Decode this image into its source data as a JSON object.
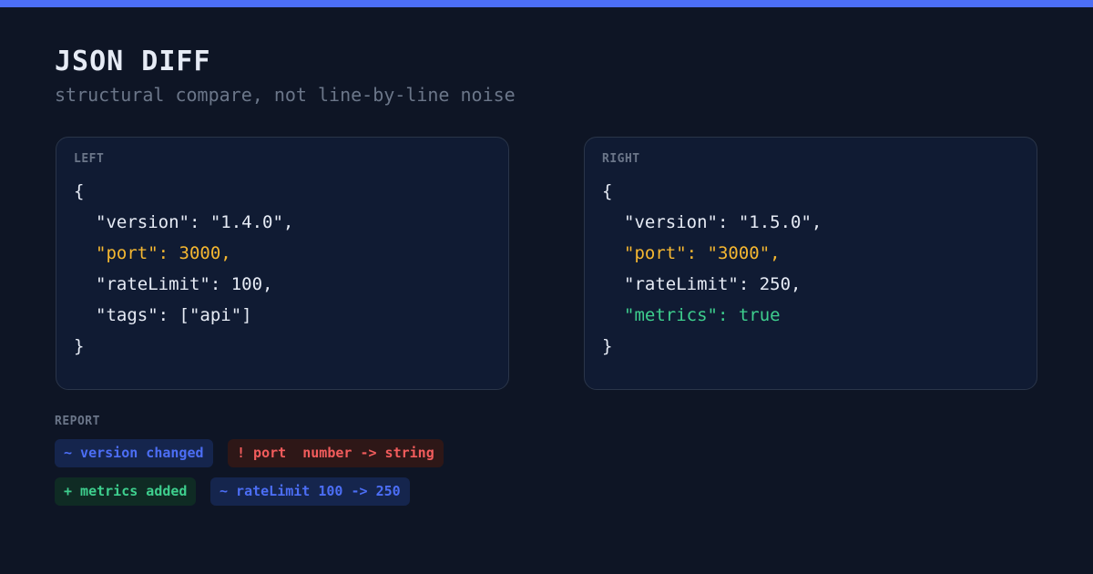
{
  "header": {
    "title": "JSON DIFF",
    "subtitle": "structural compare, not line-by-line noise"
  },
  "left_panel": {
    "label": "LEFT",
    "lines": [
      "{",
      "\"version\": \"1.4.0\",",
      "\"port\": 3000,",
      "\"rateLimit\": 100,",
      "\"tags\": [\"api\"]",
      "}"
    ]
  },
  "right_panel": {
    "label": "RIGHT",
    "lines": [
      "{",
      "\"version\": \"1.5.0\",",
      "\"port\": \"3000\",",
      "\"rateLimit\": 250,",
      "\"metrics\": true",
      "}"
    ]
  },
  "report": {
    "label": "REPORT",
    "items": [
      "~ version changed",
      "! port  number -> string",
      "+ metrics added",
      "~ rateLimit 100 -> 250"
    ]
  },
  "colors": {
    "accent": "#4c6ef5",
    "changed": "#f5b731",
    "added": "#3ecf8e",
    "error": "#f25c5c",
    "background": "#0e1525"
  }
}
